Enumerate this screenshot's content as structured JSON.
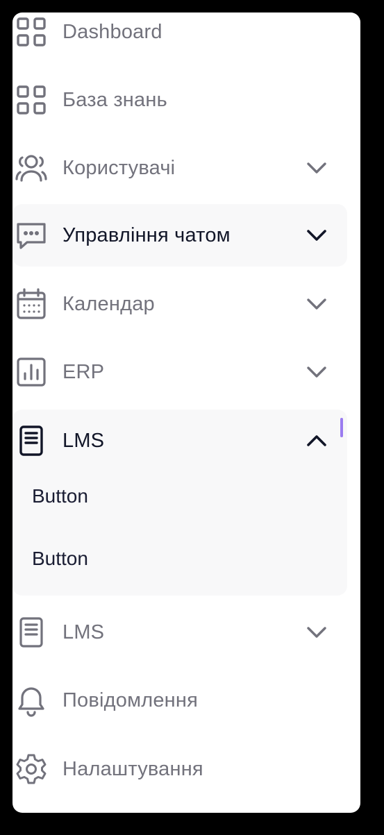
{
  "menu": {
    "items": [
      {
        "label": "Dashboard",
        "icon": "grid-icon"
      },
      {
        "label": "База знань",
        "icon": "grid-icon"
      },
      {
        "label": "Користувачі",
        "icon": "users-icon",
        "chevron": "down"
      },
      {
        "label": "Управління чатом",
        "icon": "chat-icon",
        "chevron": "down",
        "highlighted": true
      },
      {
        "label": "Календар",
        "icon": "calendar-icon",
        "chevron": "down"
      },
      {
        "label": "ERP",
        "icon": "bar-chart-icon",
        "chevron": "down"
      },
      {
        "label": "LMS",
        "icon": "document-icon",
        "chevron": "up",
        "expanded": true,
        "subitems": [
          {
            "label": "Button"
          },
          {
            "label": "Button"
          }
        ]
      },
      {
        "label": "LMS",
        "icon": "document-icon",
        "chevron": "down"
      },
      {
        "label": "Повідомлення",
        "icon": "bell-icon"
      },
      {
        "label": "Налаштування",
        "icon": "gear-icon"
      }
    ]
  },
  "colors": {
    "background": "#000000",
    "panel": "#ffffff",
    "active_bg": "#f8f8f9",
    "muted_text": "#72727c",
    "dark_text": "#121628",
    "accent": "#9b7cf0"
  }
}
